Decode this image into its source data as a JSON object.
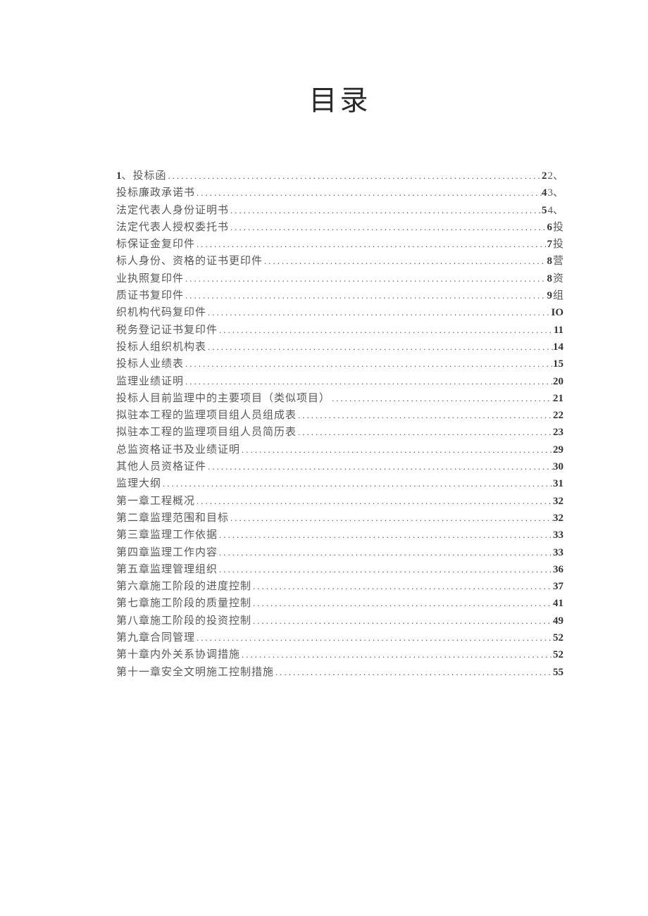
{
  "title": "目录",
  "toc": [
    {
      "prefix": "1",
      "label": "、投标函",
      "page": "2",
      "suffix": "2、"
    },
    {
      "label": "投标廉政承诺书",
      "page": "4",
      "suffix": "3、"
    },
    {
      "label": "法定代表人身份证明书",
      "page": "5",
      "suffix": "4、"
    },
    {
      "label": "法定代表人授权委托书",
      "page": "6",
      "suffix": "投"
    },
    {
      "label": "标保证金复印件",
      "page": "7",
      "suffix": "投"
    },
    {
      "label": "标人身份、资格的证书更印件",
      "page": "8",
      "suffix": "营"
    },
    {
      "label": "业执照复印件",
      "page": "8",
      "suffix": "资"
    },
    {
      "label": "质证书复印件",
      "page": "9",
      "suffix": "组"
    },
    {
      "label": "织机构代码复印件",
      "page": "IO",
      "suffix": ""
    },
    {
      "label": "税务登记证书复印件",
      "page": "11",
      "suffix": ""
    },
    {
      "label": "投标人组织机构表",
      "page": "14",
      "suffix": ""
    },
    {
      "label": "投标人业绩表",
      "page": "15",
      "suffix": ""
    },
    {
      "label": "监理业绩证明",
      "page": "20",
      "suffix": ""
    },
    {
      "label": "投标人目前监理中的主要项目（类似项目）",
      "page": "21",
      "suffix": ""
    },
    {
      "label": "拟驻本工程的监理项目组人员组成表",
      "page": "22",
      "suffix": ""
    },
    {
      "label": "拟驻本工程的监理项目组人员简历表",
      "page": "23",
      "suffix": ""
    },
    {
      "label": "总监资格证书及业绩证明",
      "page": "29",
      "suffix": ""
    },
    {
      "label": "其他人员资格证件",
      "page": "30",
      "suffix": ""
    },
    {
      "label": "监理大纲",
      "page": "31",
      "suffix": ""
    },
    {
      "label": "第一章工程概况",
      "page": "32",
      "suffix": ""
    },
    {
      "label": "第二章监理范围和目标",
      "page": "32",
      "suffix": ""
    },
    {
      "label": "第三章监理工作依据",
      "page": "33",
      "suffix": ""
    },
    {
      "label": "第四章监理工作内容",
      "page": "33",
      "suffix": ""
    },
    {
      "label": "第五章监理管理组织",
      "page": "36",
      "suffix": ""
    },
    {
      "label": "第六章施工阶段的进度控制",
      "page": "37",
      "suffix": ""
    },
    {
      "label": "第七章施工阶段的质量控制",
      "page": "41",
      "suffix": ""
    },
    {
      "label": "第八章施工阶段的投资控制",
      "page": "49",
      "suffix": ""
    },
    {
      "label": "第九章合同管理",
      "page": "52",
      "suffix": ""
    },
    {
      "label": "第十章内外关系协调措施",
      "page": "52",
      "suffix": ""
    },
    {
      "label": "第十一章安全文明施工控制措施",
      "page": "55",
      "suffix": ""
    }
  ]
}
